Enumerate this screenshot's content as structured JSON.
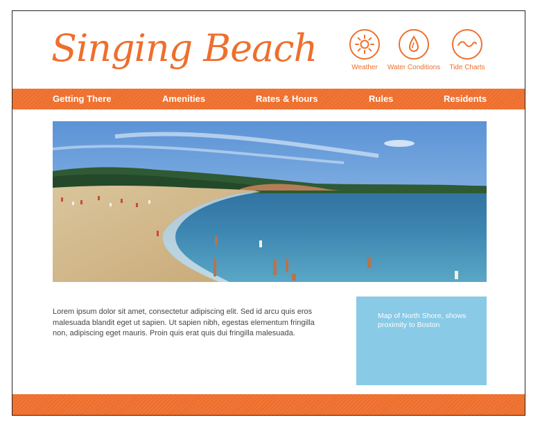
{
  "site": {
    "title": "Singing Beach"
  },
  "quick_links": [
    {
      "label": "Weather",
      "icon": "sun-icon"
    },
    {
      "label": "Water Conditions",
      "icon": "water-drop-icon"
    },
    {
      "label": "Tide Charts",
      "icon": "wave-icon"
    }
  ],
  "nav": [
    {
      "label": "Getting There"
    },
    {
      "label": "Amenities"
    },
    {
      "label": "Rates & Hours"
    },
    {
      "label": "Rules"
    },
    {
      "label": "Residents"
    }
  ],
  "hero": {
    "description": "beach-photo"
  },
  "content": {
    "body": "Lorem ipsum dolor sit amet, consectetur adipiscing elit. Sed id arcu quis eros malesuada blandit eget ut sapien. Ut sapien nibh, egestas elementum fringilla non, adipiscing eget mauris. Proin quis erat quis dui fringilla malesuada."
  },
  "map": {
    "caption": "Map of North Shore, shows proximity to Boston"
  },
  "colors": {
    "accent": "#ee6f2d",
    "map_bg": "#89cae6"
  }
}
